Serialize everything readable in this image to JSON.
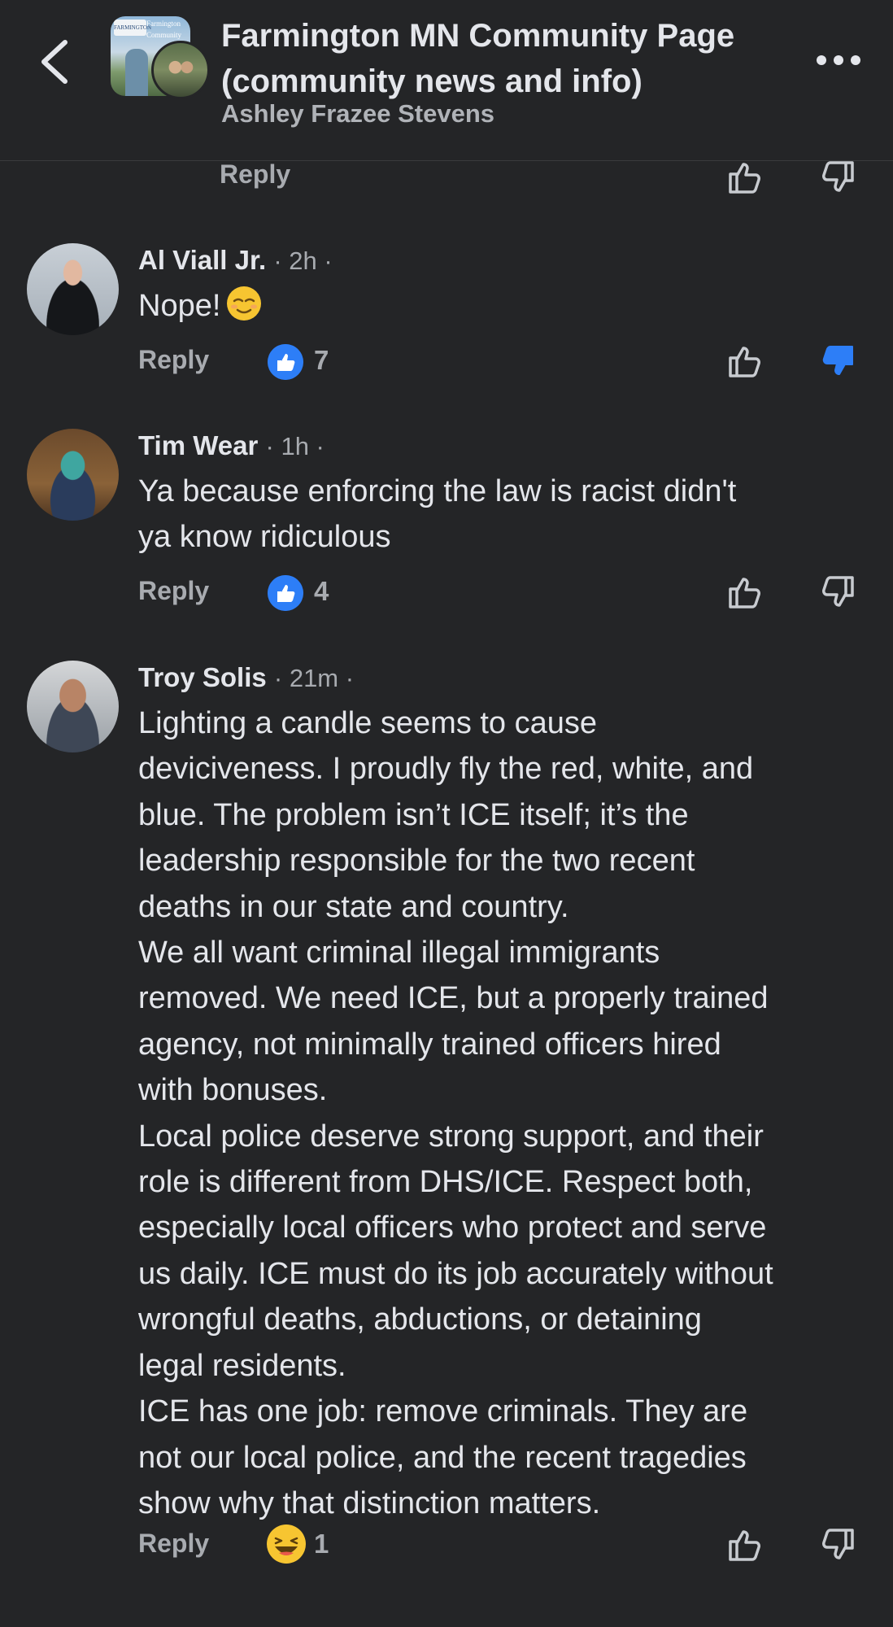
{
  "header": {
    "title": "Farmington MN Community Page (community news and info)",
    "subtitle": "Ashley Frazee Stevens",
    "thumb_sign_left": "FARMINGTON",
    "thumb_sign_right": "Farmington Community"
  },
  "previous_comment": {
    "reply_label": "Reply"
  },
  "comments": [
    {
      "author": "Al Viall Jr.",
      "time": "· 2h ·",
      "lines": [
        "Nope!"
      ],
      "emoji": "relieved-face",
      "reply_label": "Reply",
      "reaction_count": "7",
      "reaction_type": "like",
      "disliked": true
    },
    {
      "author": "Tim Wear",
      "time": "· 1h ·",
      "lines": [
        "Ya because enforcing the law is racist didn't",
        "ya know ridiculous"
      ],
      "reply_label": "Reply",
      "reaction_count": "4",
      "reaction_type": "like",
      "disliked": false
    },
    {
      "author": "Troy Solis",
      "time": "· 21m ·",
      "lines": [
        "Lighting a candle seems to cause",
        "deviciveness.  I proudly fly the red, white, and",
        "blue. The problem isn’t ICE itself; it’s the",
        "leadership responsible for the two recent",
        "deaths in our state and country.",
        "We all want criminal illegal immigrants",
        "removed. We need ICE, but a properly trained",
        "agency, not minimally trained officers hired",
        "with bonuses.",
        "Local police deserve strong support, and their",
        "role is different from DHS/ICE. Respect both,",
        "especially local officers who protect and serve",
        "us daily. ICE must do its job accurately without",
        "wrongful deaths, abductions, or detaining",
        "legal residents.",
        "ICE has one job: remove criminals. They are",
        "not our local police, and the recent tragedies",
        "show why that distinction matters."
      ],
      "reply_label": "Reply",
      "reaction_count": "1",
      "reaction_type": "haha",
      "disliked": false
    }
  ],
  "colors": {
    "background": "#242527",
    "text_primary": "#e4e6eb",
    "text_secondary": "#a8abb0",
    "accent_blue": "#2d7ef7",
    "haha_yellow": "#f7c531"
  },
  "icons": {
    "back": "chevron-left-icon",
    "more": "more-horizontal-icon",
    "like": "thumbs-up-outline-icon",
    "dislike": "thumbs-down-outline-icon",
    "dislike_active": "thumbs-down-filled-icon",
    "reaction_like": "like-reaction-icon",
    "reaction_haha": "haha-reaction-icon"
  }
}
